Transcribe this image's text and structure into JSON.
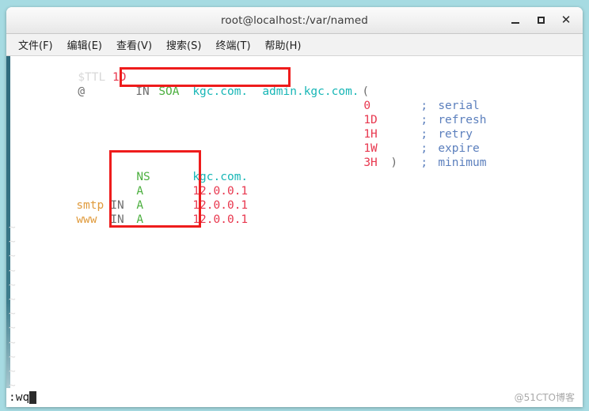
{
  "window": {
    "title": "root@localhost:/var/named",
    "buttons": {
      "minimize": "minimize",
      "maximize": "maximize",
      "close": "close",
      "close_glyph": "✕"
    }
  },
  "menubar": {
    "items": [
      {
        "label": "文件(F)"
      },
      {
        "label": "编辑(E)"
      },
      {
        "label": "查看(V)"
      },
      {
        "label": "搜索(S)"
      },
      {
        "label": "终端(T)"
      },
      {
        "label": "帮助(H)"
      }
    ]
  },
  "editor": {
    "filetype": "dns-zone",
    "lines": {
      "l1_directive": "$TTL",
      "l1_value": "1D",
      "l2_origin": "@",
      "l2_class": "IN",
      "l2_type": "SOA",
      "l2_nameserver": "kgc.com.",
      "l2_rname": "admin.kgc.com.",
      "l2_open_paren": "(",
      "l3_serial_value": "0",
      "l3_semi": ";",
      "l3_serial_label": "serial",
      "l4_refresh_value": "1D",
      "l4_semi": ";",
      "l4_refresh_label": "refresh",
      "l5_retry_value": "1H",
      "l5_semi": ";",
      "l5_retry_label": "retry",
      "l6_expire_value": "1W",
      "l6_semi": ";",
      "l6_expire_label": "expire",
      "l7_minimum_value": "3H",
      "l7_close_paren": ")",
      "l7_semi": ";",
      "l7_minimum_label": "minimum",
      "l9_ns_type": "NS",
      "l9_ns_value": "kgc.com.",
      "l10_a_type": "A",
      "l10_a_value": "12.0.0.1",
      "l11_host": "smtp",
      "l11_class": "IN",
      "l11_type": "A",
      "l11_value": "12.0.0.1",
      "l12_host": "www",
      "l12_class": "IN",
      "l12_type": "A",
      "l12_value": "12.0.0.1"
    },
    "empty_line_marker": "~",
    "empty_line_count": 12,
    "status_command": ":wq"
  },
  "annotations": [
    {
      "name": "soa-nameserver-highlight"
    },
    {
      "name": "record-values-highlight"
    }
  ],
  "watermark": {
    "text": "@51CTO博客"
  },
  "colors": {
    "annotation": "#ee1c1c",
    "host": "#17b6b6",
    "number": "#e8384f",
    "type": "#4caf3f",
    "ident": "#e09b3d",
    "comment": "#5b7fbd",
    "desktop": "#a6dbe2"
  }
}
